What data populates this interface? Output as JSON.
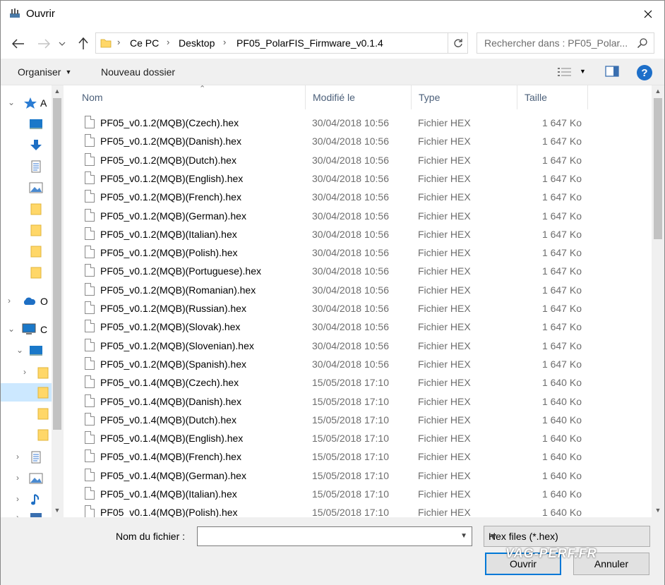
{
  "window": {
    "title": "Ouvrir"
  },
  "address": {
    "crumbs": [
      "Ce PC",
      "Desktop",
      "PF05_PolarFIS_Firmware_v0.1.4"
    ]
  },
  "search": {
    "placeholder": "Rechercher dans : PF05_Polar..."
  },
  "toolbar": {
    "organise": "Organiser",
    "new_folder": "Nouveau dossier",
    "help": "?"
  },
  "navpane": {
    "labels": [
      "A",
      "O",
      "C"
    ]
  },
  "columns": {
    "name": "Nom",
    "modified": "Modifié le",
    "type": "Type",
    "size": "Taille"
  },
  "files": [
    {
      "name": "PF05_v0.1.2(MQB)(Czech).hex",
      "date": "30/04/2018 10:56",
      "type": "Fichier HEX",
      "size": "1 647 Ko"
    },
    {
      "name": "PF05_v0.1.2(MQB)(Danish).hex",
      "date": "30/04/2018 10:56",
      "type": "Fichier HEX",
      "size": "1 647 Ko"
    },
    {
      "name": "PF05_v0.1.2(MQB)(Dutch).hex",
      "date": "30/04/2018 10:56",
      "type": "Fichier HEX",
      "size": "1 647 Ko"
    },
    {
      "name": "PF05_v0.1.2(MQB)(English).hex",
      "date": "30/04/2018 10:56",
      "type": "Fichier HEX",
      "size": "1 647 Ko"
    },
    {
      "name": "PF05_v0.1.2(MQB)(French).hex",
      "date": "30/04/2018 10:56",
      "type": "Fichier HEX",
      "size": "1 647 Ko"
    },
    {
      "name": "PF05_v0.1.2(MQB)(German).hex",
      "date": "30/04/2018 10:56",
      "type": "Fichier HEX",
      "size": "1 647 Ko"
    },
    {
      "name": "PF05_v0.1.2(MQB)(Italian).hex",
      "date": "30/04/2018 10:56",
      "type": "Fichier HEX",
      "size": "1 647 Ko"
    },
    {
      "name": "PF05_v0.1.2(MQB)(Polish).hex",
      "date": "30/04/2018 10:56",
      "type": "Fichier HEX",
      "size": "1 647 Ko"
    },
    {
      "name": "PF05_v0.1.2(MQB)(Portuguese).hex",
      "date": "30/04/2018 10:56",
      "type": "Fichier HEX",
      "size": "1 647 Ko"
    },
    {
      "name": "PF05_v0.1.2(MQB)(Romanian).hex",
      "date": "30/04/2018 10:56",
      "type": "Fichier HEX",
      "size": "1 647 Ko"
    },
    {
      "name": "PF05_v0.1.2(MQB)(Russian).hex",
      "date": "30/04/2018 10:56",
      "type": "Fichier HEX",
      "size": "1 647 Ko"
    },
    {
      "name": "PF05_v0.1.2(MQB)(Slovak).hex",
      "date": "30/04/2018 10:56",
      "type": "Fichier HEX",
      "size": "1 647 Ko"
    },
    {
      "name": "PF05_v0.1.2(MQB)(Slovenian).hex",
      "date": "30/04/2018 10:56",
      "type": "Fichier HEX",
      "size": "1 647 Ko"
    },
    {
      "name": "PF05_v0.1.2(MQB)(Spanish).hex",
      "date": "30/04/2018 10:56",
      "type": "Fichier HEX",
      "size": "1 647 Ko"
    },
    {
      "name": "PF05_v0.1.4(MQB)(Czech).hex",
      "date": "15/05/2018 17:10",
      "type": "Fichier HEX",
      "size": "1 640 Ko"
    },
    {
      "name": "PF05_v0.1.4(MQB)(Danish).hex",
      "date": "15/05/2018 17:10",
      "type": "Fichier HEX",
      "size": "1 640 Ko"
    },
    {
      "name": "PF05_v0.1.4(MQB)(Dutch).hex",
      "date": "15/05/2018 17:10",
      "type": "Fichier HEX",
      "size": "1 640 Ko"
    },
    {
      "name": "PF05_v0.1.4(MQB)(English).hex",
      "date": "15/05/2018 17:10",
      "type": "Fichier HEX",
      "size": "1 640 Ko"
    },
    {
      "name": "PF05_v0.1.4(MQB)(French).hex",
      "date": "15/05/2018 17:10",
      "type": "Fichier HEX",
      "size": "1 640 Ko"
    },
    {
      "name": "PF05_v0.1.4(MQB)(German).hex",
      "date": "15/05/2018 17:10",
      "type": "Fichier HEX",
      "size": "1 640 Ko"
    },
    {
      "name": "PF05_v0.1.4(MQB)(Italian).hex",
      "date": "15/05/2018 17:10",
      "type": "Fichier HEX",
      "size": "1 640 Ko"
    },
    {
      "name": "PF05_v0.1.4(MQB)(Polish).hex",
      "date": "15/05/2018 17:10",
      "type": "Fichier HEX",
      "size": "1 640 Ko"
    }
  ],
  "bottom": {
    "filename_label": "Nom du fichier :",
    "filename_value": "",
    "filter": "Hex files (*.hex)",
    "open": "Ouvrir",
    "cancel": "Annuler"
  },
  "watermark": "VAG-PERF.FR",
  "colors": {
    "accent": "#0078d7",
    "selection": "#cce8ff",
    "folder": "#ffd768"
  }
}
